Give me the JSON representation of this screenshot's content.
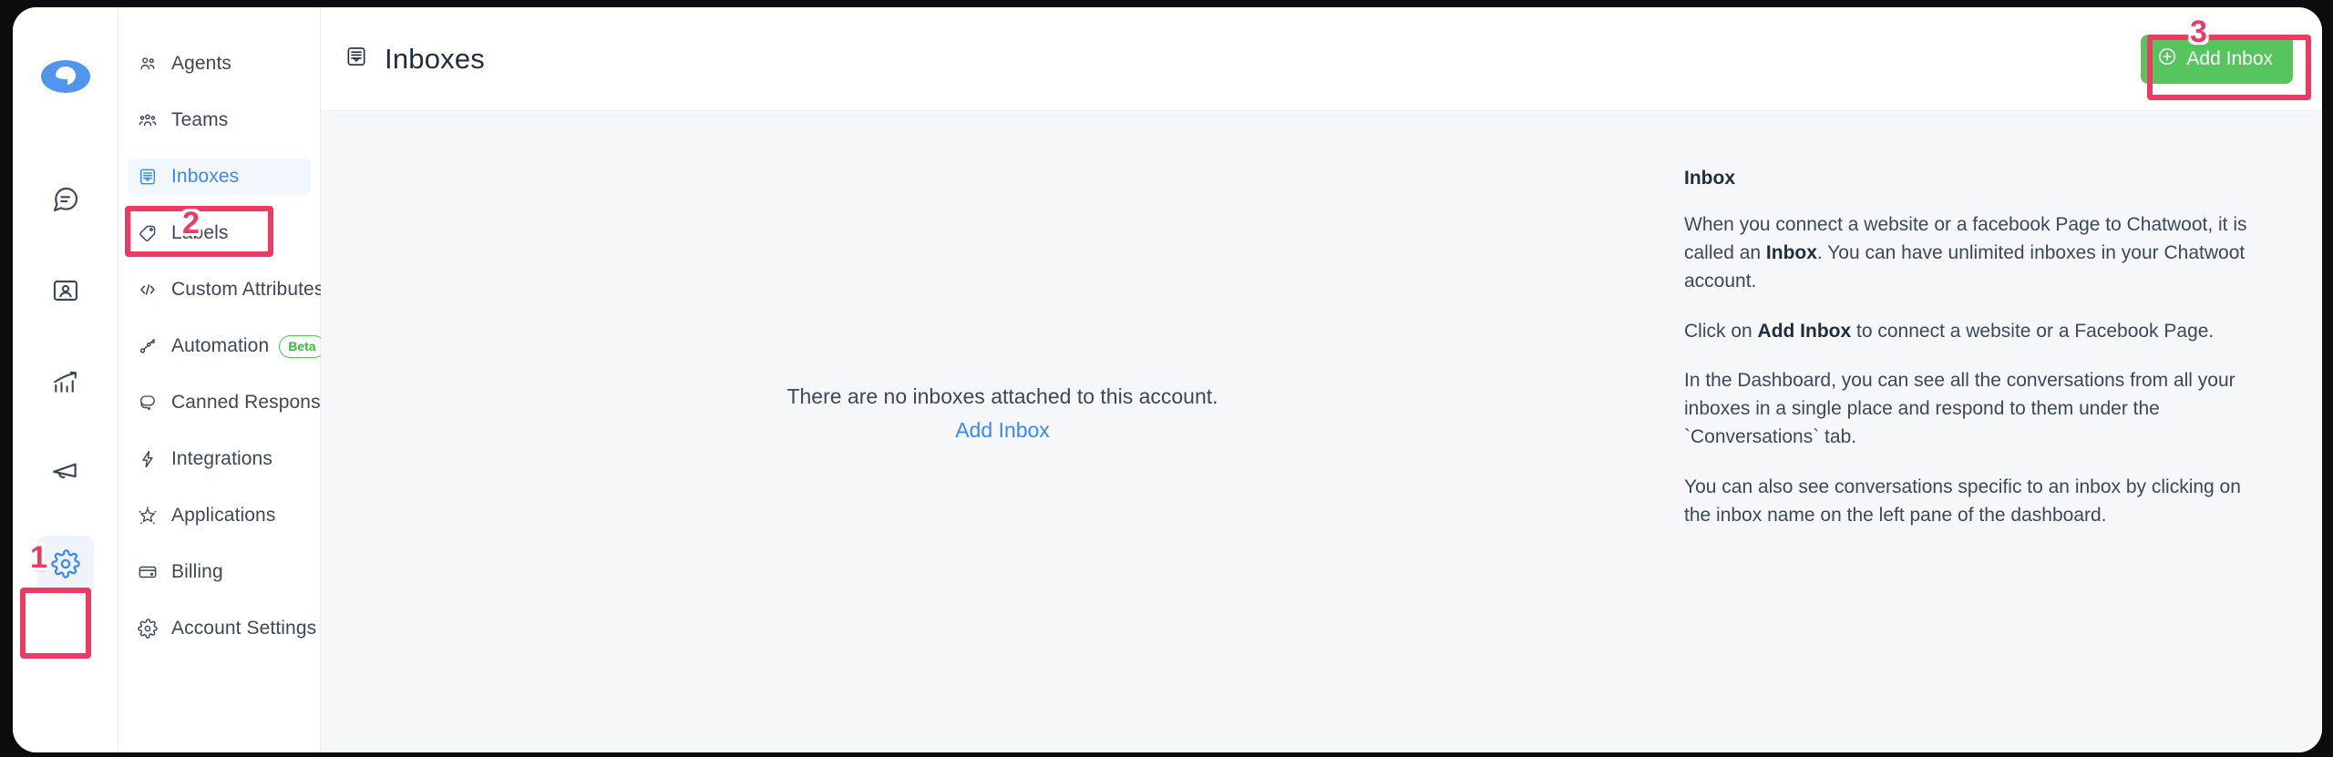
{
  "colors": {
    "brand_blue": "#3b87f5",
    "accent_green": "#57c55e",
    "annotation_red": "#ed3a63",
    "text_dark": "#1f2d3d",
    "text_body": "#3c4858",
    "content_bg": "#f6f7f9",
    "active_item_bg": "#f2f6fd",
    "beta_green": "#3ab845"
  },
  "rail": {
    "logo_icon": "chatwoot-logo-icon",
    "items": [
      {
        "icon": "conversations-chat-icon",
        "name": "conversations",
        "active": false
      },
      {
        "icon": "contacts-icon",
        "name": "contacts",
        "active": false
      },
      {
        "icon": "reports-bar-chart-icon",
        "name": "reports",
        "active": false
      },
      {
        "icon": "campaigns-megaphone-icon",
        "name": "campaigns",
        "active": false
      },
      {
        "icon": "settings-gear-icon",
        "name": "settings",
        "active": true
      }
    ]
  },
  "settings_menu": {
    "items": [
      {
        "label": "Agents",
        "icon": "agents-people-icon",
        "active": false,
        "badge": null
      },
      {
        "label": "Teams",
        "icon": "teams-group-icon",
        "active": false,
        "badge": null
      },
      {
        "label": "Inboxes",
        "icon": "inbox-tray-icon",
        "active": true,
        "badge": null
      },
      {
        "label": "Labels",
        "icon": "label-tag-icon",
        "active": false,
        "badge": null
      },
      {
        "label": "Custom Attributes",
        "icon": "code-brackets-icon",
        "active": false,
        "badge": null
      },
      {
        "label": "Automation",
        "icon": "automation-nodes-icon",
        "active": false,
        "badge": "Beta"
      },
      {
        "label": "Canned Responses",
        "icon": "canned-responses-chat-icon",
        "active": false,
        "badge": null
      },
      {
        "label": "Integrations",
        "icon": "integrations-bolt-icon",
        "active": false,
        "badge": null
      },
      {
        "label": "Applications",
        "icon": "applications-star-icon",
        "active": false,
        "badge": null
      },
      {
        "label": "Billing",
        "icon": "billing-card-icon",
        "active": false,
        "badge": null
      },
      {
        "label": "Account Settings",
        "icon": "account-settings-gear-icon",
        "active": false,
        "badge": null
      }
    ]
  },
  "header": {
    "title": "Inboxes",
    "title_icon": "inbox-tray-icon",
    "add_inbox_label": "Add Inbox",
    "add_inbox_icon": "plus-circle-icon"
  },
  "empty_state": {
    "message": "There are no inboxes attached to this account.",
    "link_label": "Add Inbox"
  },
  "help_panel": {
    "title": "Inbox",
    "paragraphs": [
      {
        "parts": [
          {
            "text": "When you connect a website or a facebook Page to Chatwoot, it is called an ",
            "bold": false
          },
          {
            "text": "Inbox",
            "bold": true
          },
          {
            "text": ". You can have unlimited inboxes in your Chatwoot account.",
            "bold": false
          }
        ]
      },
      {
        "parts": [
          {
            "text": "Click on ",
            "bold": false
          },
          {
            "text": "Add Inbox",
            "bold": true
          },
          {
            "text": " to connect a website or a Facebook Page.",
            "bold": false
          }
        ]
      },
      {
        "parts": [
          {
            "text": "In the Dashboard, you can see all the conversations from all your inboxes in a single place and respond to them under the `Conversations` tab.",
            "bold": false
          }
        ]
      },
      {
        "parts": [
          {
            "text": "You can also see conversations specific to an inbox by clicking on the inbox name on the left pane of the dashboard.",
            "bold": false
          }
        ]
      }
    ]
  },
  "annotations": [
    {
      "number": "1",
      "target": "settings-gear-rail-icon"
    },
    {
      "number": "2",
      "target": "sidebar-item-inboxes"
    },
    {
      "number": "3",
      "target": "add-inbox-button"
    }
  ]
}
